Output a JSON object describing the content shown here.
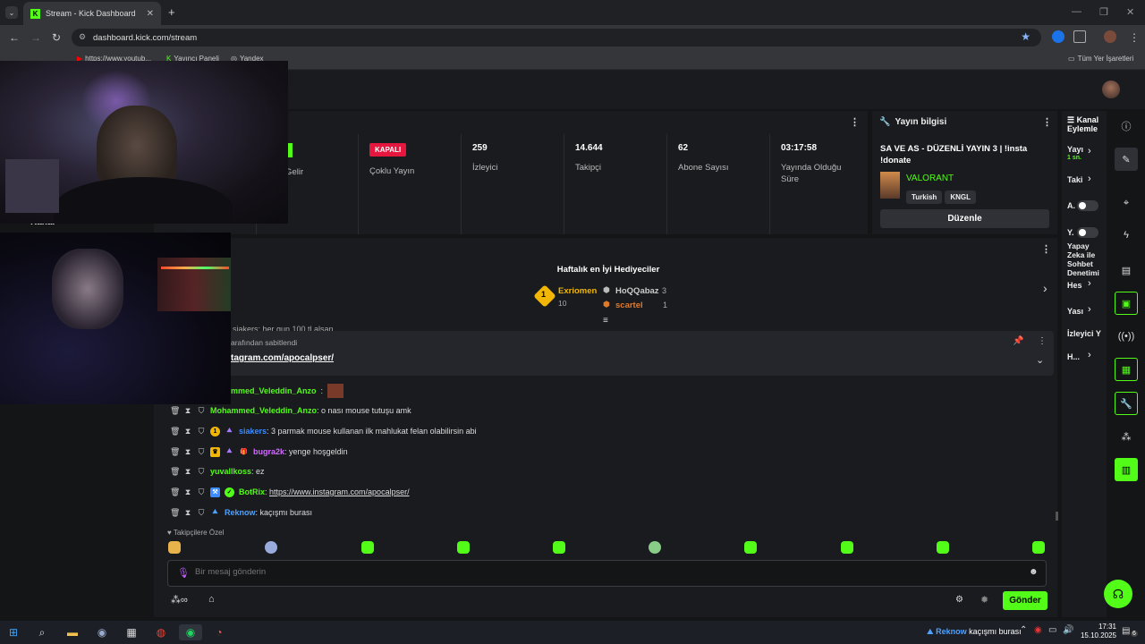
{
  "browser": {
    "tab_title": "Stream - Kick Dashboard",
    "tab_icon_letter": "K",
    "url": "dashboard.kick.com/stream",
    "bookmarks": [
      "https://www.youtub...",
      "Yayıncı Paneli",
      "Yandex"
    ],
    "bookmarks_all": "Tüm Yer İşaretleri"
  },
  "stats": {
    "partial_label": "erlik Gelir\namı",
    "multistream_status": "KAPALI",
    "multistream_label": "Çoklu Yayın",
    "viewers_value": "259",
    "viewers_label": "İzleyici",
    "followers_value": "14.644",
    "followers_label": "Takipçi",
    "subs_value": "62",
    "subs_label": "Abone Sayısı",
    "uptime_value": "03:17:58",
    "uptime_label": "Yayında Olduğu Süre"
  },
  "stream_info": {
    "header": "Yayın bilgisi",
    "title": "SA VE AS - DÜZENLİ YAYIN 3 | !insta !donate",
    "category": "VALORANT",
    "tags": [
      "Turkish",
      "KNGL"
    ],
    "edit_button": "Düzenle"
  },
  "gifters": {
    "title": "Haftalık en İyi Hediyeciler",
    "first": {
      "rank": "1",
      "name": "Exriomen",
      "count": "10"
    },
    "second": {
      "name": "HoQQabaz",
      "count": "3"
    },
    "third": {
      "name": "scartel",
      "count": "1"
    }
  },
  "pinned": {
    "partial_msg": "siakers: her gun 100 tl alsan",
    "pinned_by": "arafından sabitlendi",
    "link": "tagram.com/apocalpser/"
  },
  "chat": [
    {
      "user": "mmed_Veleddin_Anzo",
      "color": "#53fc18",
      "text": ""
    },
    {
      "user": "Mohammed_Veleddin_Anzo",
      "color": "#53fc18",
      "text": "o nası mouse tutuşu amk"
    },
    {
      "user": "siakers",
      "color": "#3d8bfd",
      "text": "3 parmak mouse kullanan ilk mahlukat felan olabilirsin abi"
    },
    {
      "user": "bugra2k",
      "color": "#d26bff",
      "text": "yenge hoşgeldin"
    },
    {
      "user": "yuvallkoss",
      "color": "#53fc18",
      "text": "ez"
    },
    {
      "user": "BotRix",
      "color": "#53fc18",
      "text": "https://www.instagram.com/apocalpser/"
    },
    {
      "user": "Reknow",
      "color": "#4ea1ff",
      "text": "kaçışmı burası"
    }
  ],
  "emote_section": "Takipçilere Özel",
  "chat_input_placeholder": "Bir mesaj gönderin",
  "send_button": "Gönder",
  "channel_actions": {
    "header": "Kanal\nEylemle",
    "items": [
      "Yayı",
      "1 sn.",
      "Taki",
      "A.",
      "Y.",
      "Yapay Zeka ile Sohbet Denetimi",
      "Hes",
      "Yası",
      "İzleyici Y",
      "H..."
    ]
  },
  "left_partial": "Kanal",
  "taskbar": {
    "notify_user": "Reknow",
    "notify_text": "kaçışmı burası",
    "time": "17:31",
    "date": "15.10.2025",
    "badge": "6"
  },
  "colors": {
    "kick_green": "#53fc18",
    "bg": "#141517",
    "panel": "#191b1f",
    "red": "#e5173f"
  }
}
